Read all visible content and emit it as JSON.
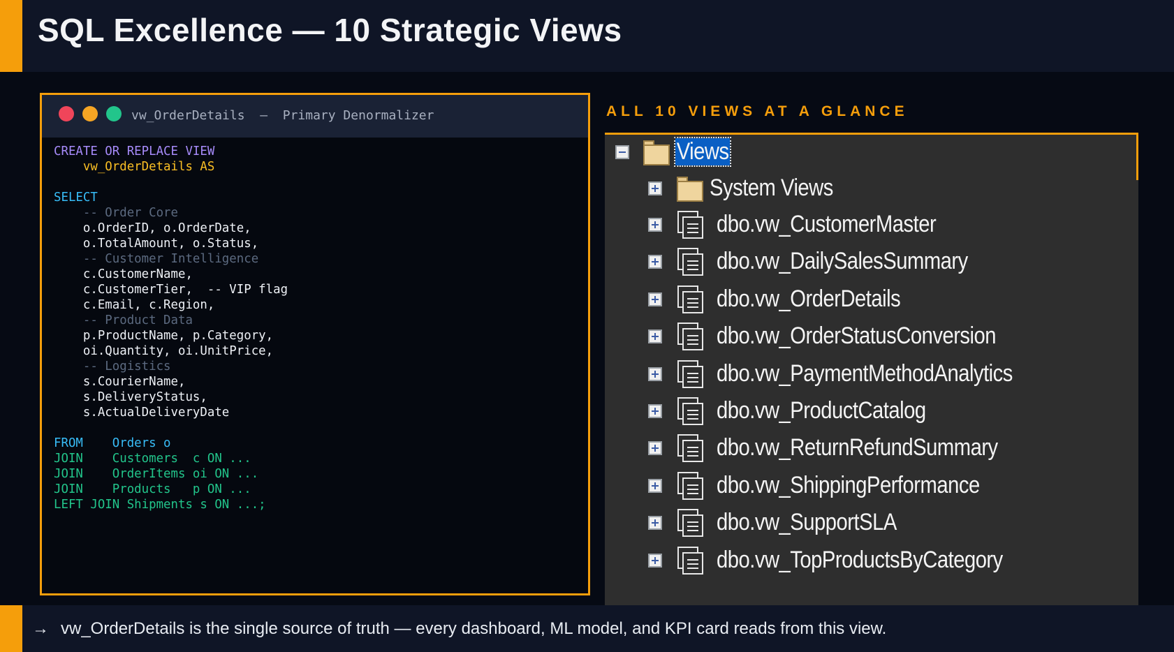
{
  "header": {
    "title": "SQL Excellence — 10 Strategic Views"
  },
  "code_window": {
    "title": "vw_OrderDetails  —  Primary Denormalizer",
    "lines": [
      [
        [
          "kw",
          "CREATE OR REPLACE VIEW"
        ]
      ],
      [
        [
          "vn",
          "    vw_OrderDetails AS"
        ]
      ],
      [],
      [
        [
          "sel",
          "SELECT"
        ]
      ],
      [
        [
          "cm",
          "    -- Order Core"
        ]
      ],
      [
        [
          "tx",
          "    o.OrderID, o.OrderDate,"
        ]
      ],
      [
        [
          "tx",
          "    o.TotalAmount, o.Status,"
        ]
      ],
      [
        [
          "cm",
          "    -- Customer Intelligence"
        ]
      ],
      [
        [
          "tx",
          "    c.CustomerName,"
        ]
      ],
      [
        [
          "tx",
          "    c.CustomerTier,  -- VIP flag"
        ]
      ],
      [
        [
          "tx",
          "    c.Email, c.Region,"
        ]
      ],
      [
        [
          "cm",
          "    -- Product Data"
        ]
      ],
      [
        [
          "tx",
          "    p.ProductName, p.Category,"
        ]
      ],
      [
        [
          "tx",
          "    oi.Quantity, oi.UnitPrice,"
        ]
      ],
      [
        [
          "cm",
          "    -- Logistics"
        ]
      ],
      [
        [
          "tx",
          "    s.CourierName,"
        ]
      ],
      [
        [
          "tx",
          "    s.DeliveryStatus,"
        ]
      ],
      [
        [
          "tx",
          "    s.ActualDeliveryDate"
        ]
      ],
      [],
      [
        [
          "fr",
          "FROM    Orders o"
        ]
      ],
      [
        [
          "jn",
          "JOIN    Customers  c ON ..."
        ]
      ],
      [
        [
          "jn",
          "JOIN    OrderItems oi ON ..."
        ]
      ],
      [
        [
          "jn",
          "JOIN    Products   p ON ..."
        ]
      ],
      [
        [
          "jn",
          "LEFT JOIN Shipments s ON ...;"
        ]
      ]
    ]
  },
  "panel": {
    "label": "ALL 10 VIEWS AT A GLANCE",
    "root": "Views",
    "system_folder": "System Views",
    "views": [
      "dbo.vw_CustomerMaster",
      "dbo.vw_DailySalesSummary",
      "dbo.vw_OrderDetails",
      "dbo.vw_OrderStatusConversion",
      "dbo.vw_PaymentMethodAnalytics",
      "dbo.vw_ProductCatalog",
      "dbo.vw_ReturnRefundSummary",
      "dbo.vw_ShippingPerformance",
      "dbo.vw_SupportSLA",
      "dbo.vw_TopProductsByCategory"
    ]
  },
  "footer": {
    "arrow": "→",
    "text": "vw_OrderDetails is the single source of truth — every dashboard, ML model, and KPI card reads from this view."
  }
}
